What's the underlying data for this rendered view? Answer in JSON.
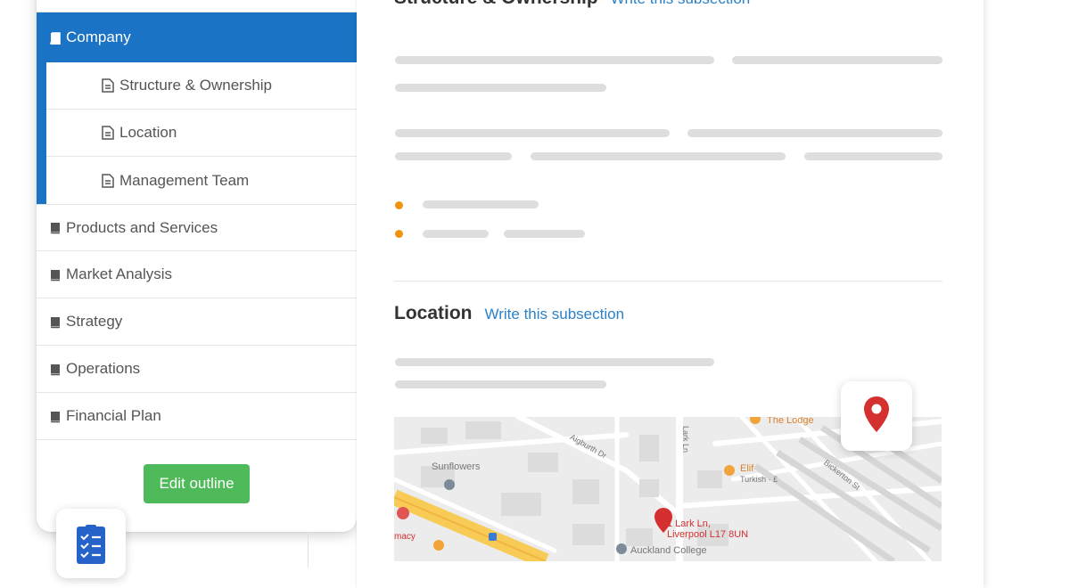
{
  "sidebar": {
    "active_item": "Company",
    "subitems": [
      "Structure & Ownership",
      "Location",
      "Management Team"
    ],
    "items": [
      "Products and Services",
      "Market Analysis",
      "Strategy",
      "Operations",
      "Financial Plan"
    ],
    "edit_button": "Edit outline"
  },
  "main": {
    "sections": [
      {
        "title": "Structure & Ownership",
        "link": "Write this subsection"
      },
      {
        "title": "Location",
        "link": "Write this subsection"
      }
    ]
  },
  "map": {
    "labels": {
      "sunflowers": "Sunflowers",
      "the_lodge": "The Lodge",
      "elif": "Elif",
      "elif_sub": "Turkish · £",
      "address_1": "1 Lark Ln,",
      "address_2": "Liverpool L17 8UN",
      "college": "Auckland College",
      "pharmacy": "macy",
      "street_1": "Aigburth Dr",
      "street_2": "Lark Ln",
      "street_3": "Bickerton St"
    }
  },
  "colors": {
    "accent": "#1a73c4",
    "button": "#4fba5a",
    "link": "#2a82c9",
    "bullet": "#f0920e",
    "pin": "#d3302f"
  },
  "icons": {
    "section": "book-icon",
    "subsection": "document-icon",
    "outline": "checklist-icon",
    "map_pin": "map-pin-icon"
  }
}
